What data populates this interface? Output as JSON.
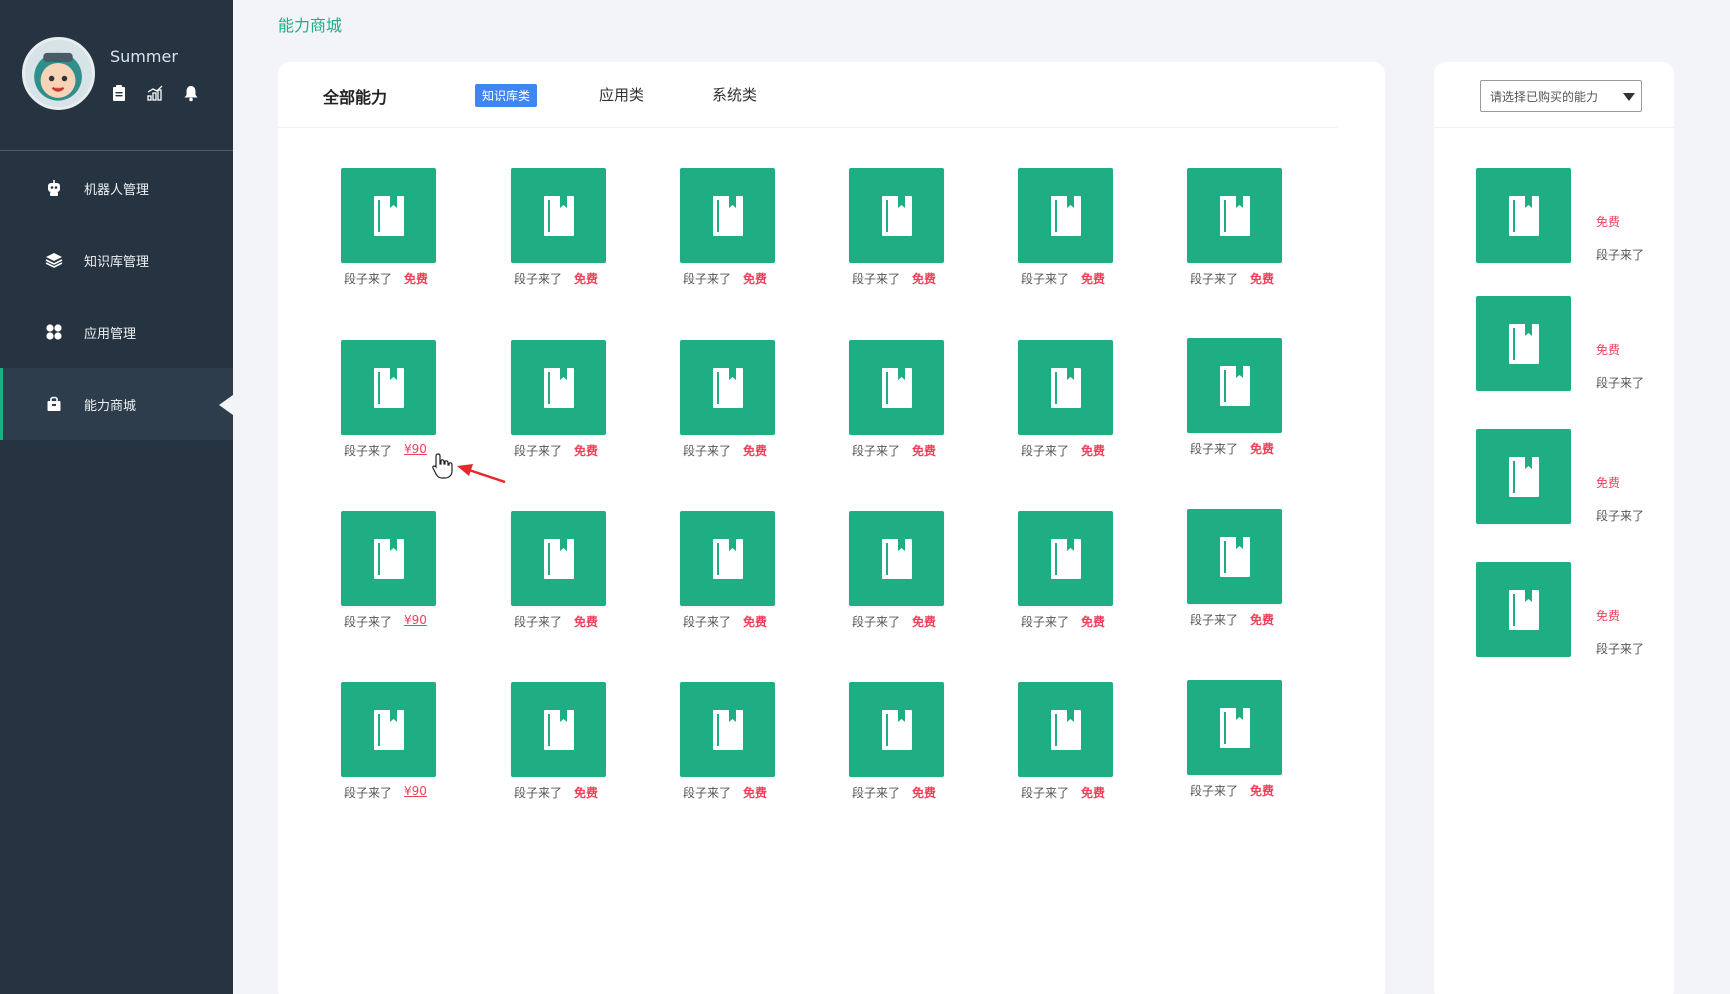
{
  "user": {
    "name": "Summer"
  },
  "sidebar": {
    "items": [
      {
        "label": "机器人管理",
        "icon": "robot-icon"
      },
      {
        "label": "知识库管理",
        "icon": "layers-icon"
      },
      {
        "label": "应用管理",
        "icon": "apps-icon"
      },
      {
        "label": "能力商城",
        "icon": "shop-bag-icon",
        "active": true
      }
    ]
  },
  "breadcrumb": "能力商城",
  "tabs": {
    "all": "全部能力",
    "kb": "知识库类",
    "app": "应用类",
    "sys": "系统类"
  },
  "grid": {
    "rows": [
      [
        {
          "name": "段子来了",
          "price": "免费"
        },
        {
          "name": "段子来了",
          "price": "免费"
        },
        {
          "name": "段子来了",
          "price": "免费"
        },
        {
          "name": "段子来了",
          "price": "免费"
        },
        {
          "name": "段子来了",
          "price": "免费"
        },
        {
          "name": "段子来了",
          "price": "免费"
        }
      ],
      [
        {
          "name": "段子来了",
          "price": "¥90"
        },
        {
          "name": "段子来了",
          "price": "免费"
        },
        {
          "name": "段子来了",
          "price": "免费"
        },
        {
          "name": "段子来了",
          "price": "免费"
        },
        {
          "name": "段子来了",
          "price": "免费"
        },
        {
          "name": "段子来了",
          "price": "免费"
        }
      ],
      [
        {
          "name": "段子来了",
          "price": "¥90"
        },
        {
          "name": "段子来了",
          "price": "免费"
        },
        {
          "name": "段子来了",
          "price": "免费"
        },
        {
          "name": "段子来了",
          "price": "免费"
        },
        {
          "name": "段子来了",
          "price": "免费"
        },
        {
          "name": "段子来了",
          "price": "免费"
        }
      ],
      [
        {
          "name": "段子来了",
          "price": "¥90"
        },
        {
          "name": "段子来了",
          "price": "免费"
        },
        {
          "name": "段子来了",
          "price": "免费"
        },
        {
          "name": "段子来了",
          "price": "免费"
        },
        {
          "name": "段子来了",
          "price": "免费"
        },
        {
          "name": "段子来了",
          "price": "免费"
        }
      ]
    ]
  },
  "purchased": {
    "placeholder": "请选择已购买的能力",
    "items": [
      {
        "price": "免费",
        "name": "段子来了"
      },
      {
        "price": "免费",
        "name": "段子来了"
      },
      {
        "price": "免费",
        "name": "段子来了"
      },
      {
        "price": "免费",
        "name": "段子来了"
      }
    ]
  },
  "colors": {
    "accent": "#1fae84",
    "sidebar": "#263340",
    "price": "#f0405a",
    "tabActive": "#3f86f0"
  }
}
